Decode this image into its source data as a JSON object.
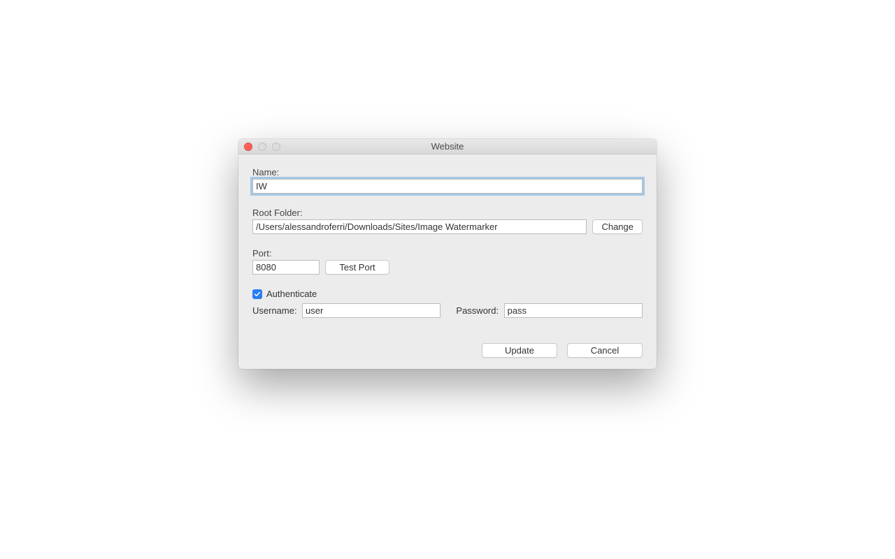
{
  "window": {
    "title": "Website"
  },
  "fields": {
    "name_label": "Name:",
    "name_value": "IW",
    "root_label": "Root Folder:",
    "root_value": "/Users/alessandroferri/Downloads/Sites/Image Watermarker",
    "change_btn": "Change",
    "port_label": "Port:",
    "port_value": "8080",
    "test_port_btn": "Test Port",
    "auth_label": "Authenticate",
    "auth_checked": true,
    "username_label": "Username:",
    "username_value": "user",
    "password_label": "Password:",
    "password_value": "pass"
  },
  "footer": {
    "update": "Update",
    "cancel": "Cancel"
  }
}
